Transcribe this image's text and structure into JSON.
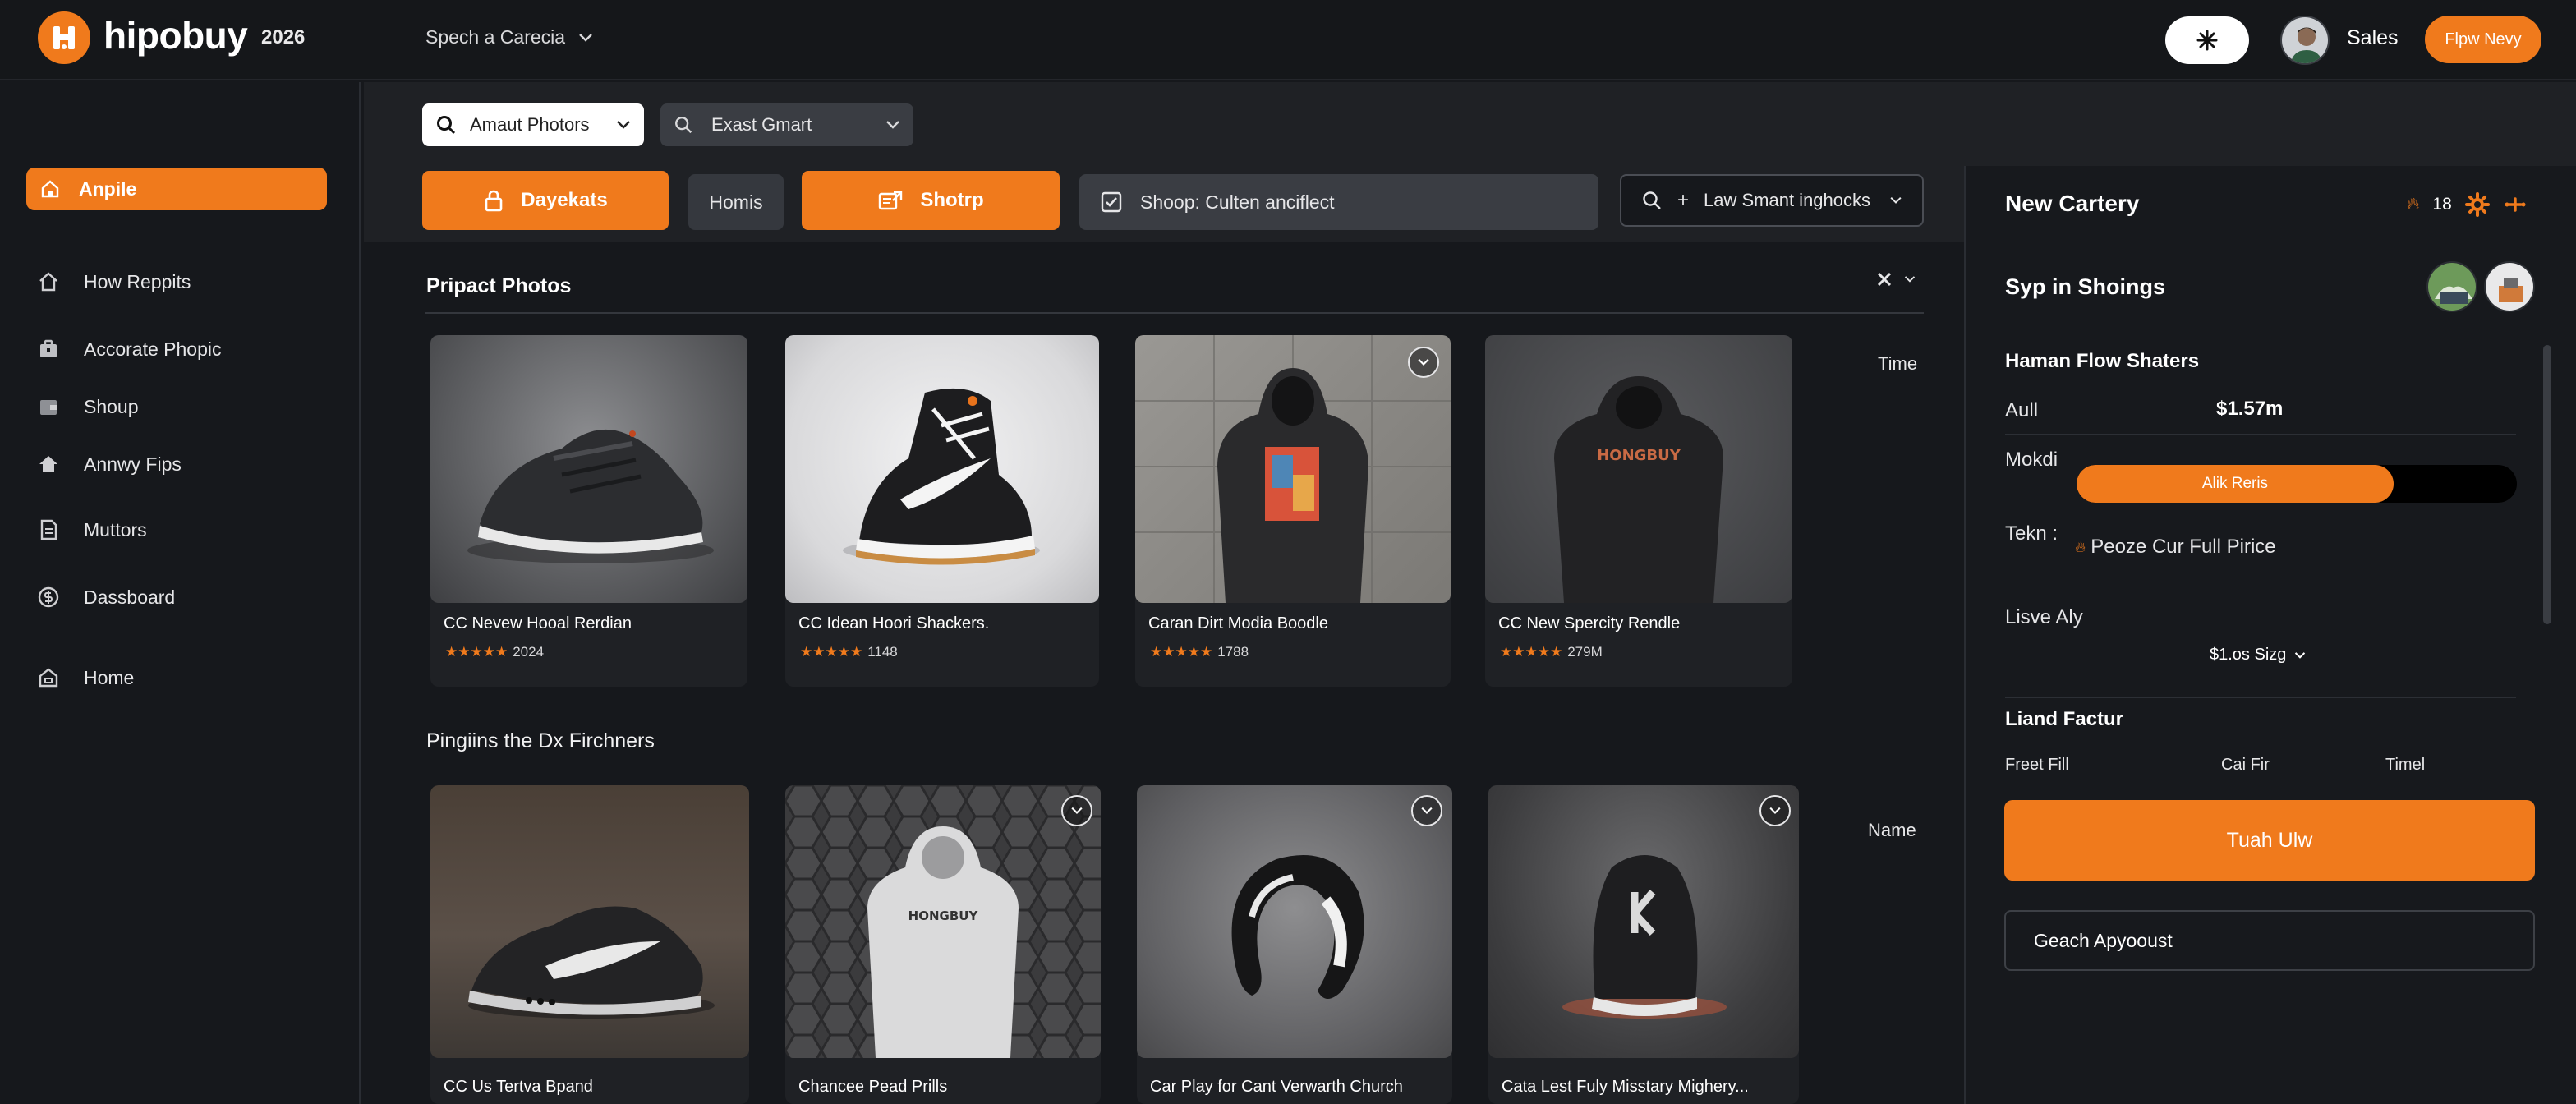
{
  "header": {
    "brand": "hipobuy",
    "year": "2026",
    "nav_dropdown": "Spech a Carecia",
    "user_name": "Sales",
    "cta_label": "Flpw Nevy"
  },
  "sidebar": {
    "items": [
      {
        "label": "Anpile",
        "icon": "home-icon",
        "active": true
      },
      {
        "label": "How Reppits",
        "icon": "house-outline-icon"
      },
      {
        "label": "Accorate Phopic",
        "icon": "briefcase-icon"
      },
      {
        "label": "Shoup",
        "icon": "wallet-icon"
      },
      {
        "label": "Annwy Fips",
        "icon": "home-solid-icon"
      },
      {
        "label": "Muttors",
        "icon": "document-icon"
      },
      {
        "label": "Dassboard",
        "icon": "dollar-icon"
      },
      {
        "label": "Home",
        "icon": "building-icon"
      }
    ]
  },
  "filters": {
    "category_select": "Amaut Photors",
    "search_select": "Exast Gmart"
  },
  "toolbar": {
    "btn1": "Dayekats",
    "btn2": "Homis",
    "btn3": "Shotrp",
    "checkbox_label": "Shoop: Culten anciflect",
    "search_label": "Law Smant inghocks"
  },
  "main": {
    "section1_title": "Pripact Photos",
    "section1_side_label": "Time",
    "section2_title": "Pingiins the Dx Firchners",
    "section2_side_label": "Name",
    "row1": [
      {
        "name": "CC Nevew Hooal Rerdian",
        "count": "2024"
      },
      {
        "name": "CC Idean Hoori Shackers.",
        "count": "1148"
      },
      {
        "name": "Caran Dirt Modia Boodle",
        "count": "1788"
      },
      {
        "name": "CC New Spercity Rendle",
        "count": "279M"
      }
    ],
    "row2": [
      {
        "name": "CC Us Tertva Bpand"
      },
      {
        "name": "Chancee Pead Prills"
      },
      {
        "name": "Car Play for Cant Verwarth Church"
      },
      {
        "name": "Cata Lest Fuly Misstary Mighery..."
      }
    ]
  },
  "right_panel": {
    "title": "New Cartery",
    "badge_count": "18",
    "subtitle": "Syp in Shoings",
    "section_label": "Haman Flow Shaters",
    "all_label": "Aull",
    "all_value": "$1.57m",
    "mokdi_label": "Mokdi",
    "progress_label": "Alik Reris",
    "progress_value": 0.72,
    "tekn_label": "Tekn :",
    "tekn_value": "Peoze Cur Full Pirice",
    "live_label": "Lisve Aly",
    "live_value": "$1.os Sizg",
    "factor_label": "Liand Factur",
    "factor_cols": [
      "Freet Fill",
      "Cai Fir",
      "Timel"
    ],
    "cta_label": "Tuah Ulw",
    "secondary_label": "Geach Apyooust"
  },
  "colors": {
    "accent": "#f07a1c",
    "background": "#16181c",
    "panel": "#1f2125"
  }
}
